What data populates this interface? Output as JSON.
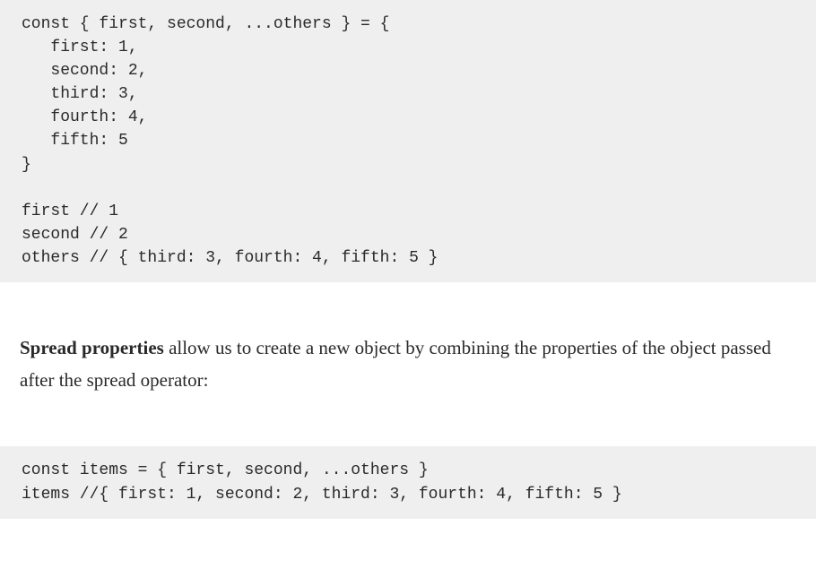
{
  "codeBlock1": "const { first, second, ...others } = {\n   first: 1,\n   second: 2,\n   third: 3,\n   fourth: 4,\n   fifth: 5\n}\n\nfirst // 1\nsecond // 2\nothers // { third: 3, fourth: 4, fifth: 5 }",
  "paragraph": {
    "strong": "Spread properties",
    "rest": " allow us to create a new object by combining the properties of the object passed after the spread operator:"
  },
  "codeBlock2": "const items = { first, second, ...others }\nitems //{ first: 1, second: 2, third: 3, fourth: 4, fifth: 5 }"
}
